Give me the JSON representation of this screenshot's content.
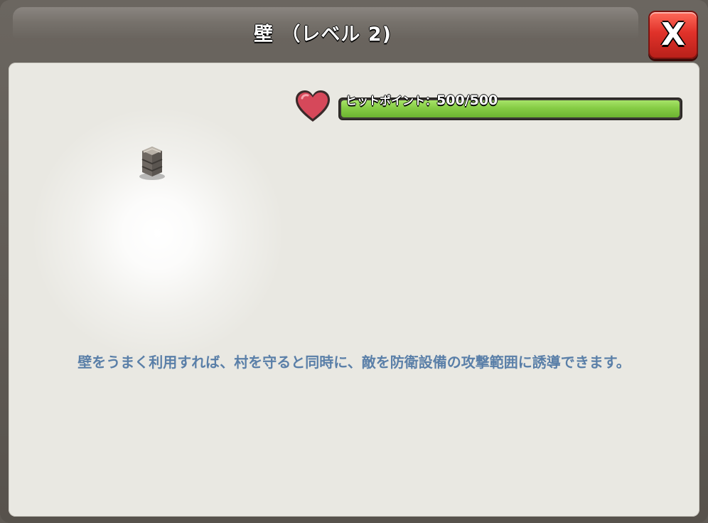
{
  "window": {
    "title": "壁 （レベル 2)",
    "close_label": "X"
  },
  "building": {
    "image": "stone-wall"
  },
  "stats": {
    "hitpoints": {
      "label": "ヒットポイント：",
      "value": "500/500",
      "fraction": 1.0,
      "icon": "heart-icon"
    }
  },
  "description": "壁をうまく利用すれば、村を守ると同時に、敵を防衛設備の攻撃範囲に誘導できます。",
  "colors": {
    "accent_red": "#e0322a",
    "hp_green": "#86cc45",
    "description_blue": "#5a7fa8"
  }
}
